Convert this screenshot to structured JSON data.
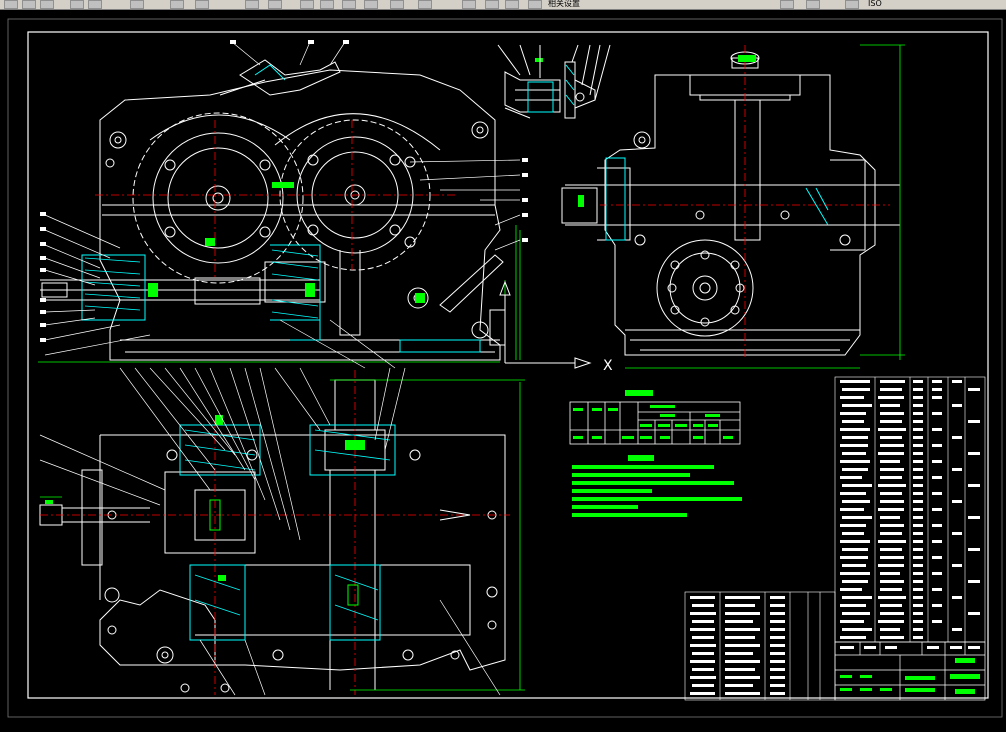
{
  "toolbar": {
    "label_mid": "相关设置",
    "label_right": "ISO"
  },
  "drawing": {
    "view_arrow_label": "X"
  },
  "colors": {
    "background": "#000000",
    "lines": "#ffffff",
    "highlight": "#00ff00",
    "hatch": "#00ffff",
    "dimension": "#00ff00",
    "leader": "#ffffff",
    "magenta": "#ff00ff",
    "toolbar": "#d4d0c8"
  }
}
